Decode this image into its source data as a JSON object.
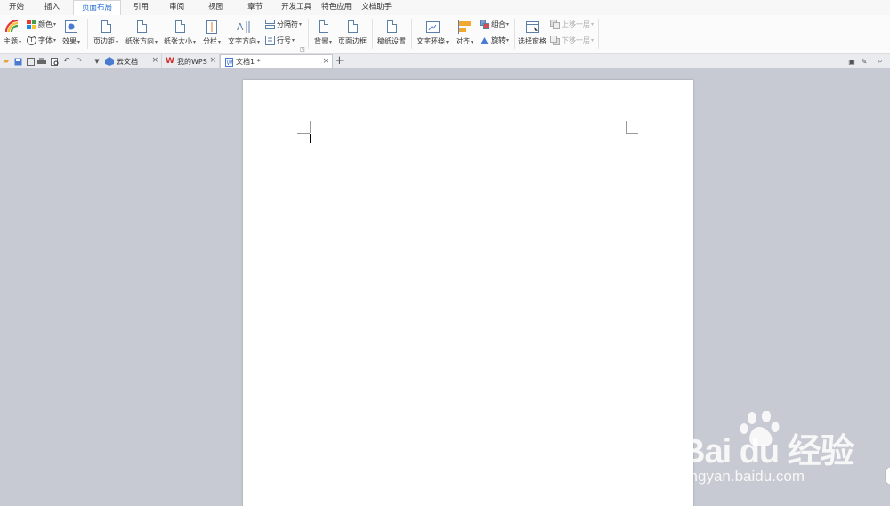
{
  "menu": {
    "tabs": [
      {
        "label": "开始"
      },
      {
        "label": "插入"
      },
      {
        "label": "页面布局",
        "active": true
      },
      {
        "label": "引用"
      },
      {
        "label": "审阅"
      },
      {
        "label": "视图"
      },
      {
        "label": "章节"
      },
      {
        "label": "开发工具"
      },
      {
        "label": "特色应用"
      },
      {
        "label": "文档助手"
      }
    ]
  },
  "ribbon": {
    "theme": "主题",
    "color": "颜色",
    "font": "字体",
    "effect": "效果",
    "margins": "页边距",
    "orientation": "纸张方向",
    "size": "纸张大小",
    "columns": "分栏",
    "text_direction": "文字方向",
    "breaks": "分隔符",
    "line_numbers": "行号",
    "background": "背景",
    "page_border": "页面边框",
    "paper_setup": "稿纸设置",
    "text_wrap": "文字环绕",
    "align": "对齐",
    "group": "组合",
    "rotate": "旋转",
    "selection_pane": "选择窗格",
    "bring_forward": "上移一层",
    "send_backward": "下移一层"
  },
  "tabstrip": {
    "tabs": [
      {
        "label": "云文档"
      },
      {
        "label": "我的WPS"
      },
      {
        "label": "文档1 *",
        "active": true
      }
    ],
    "add": "+",
    "close": "×"
  },
  "watermark": {
    "logo": "Bai du 经验",
    "url": "jingyan.baidu.com"
  },
  "colors": {
    "accent": "#2a6fce",
    "workspace": "#c7cad2",
    "page": "#ffffff"
  }
}
